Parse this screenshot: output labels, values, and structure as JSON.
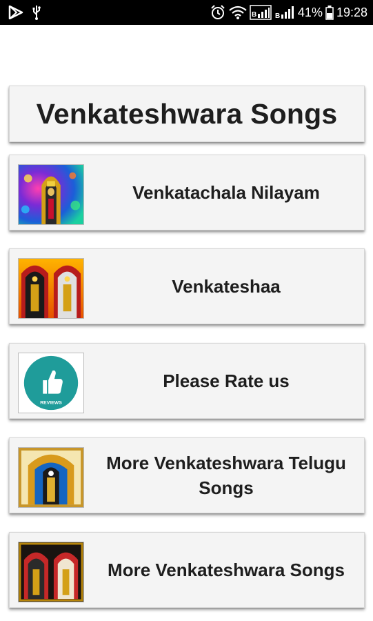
{
  "status_bar": {
    "battery_percent": "41%",
    "time": "19:28",
    "icons": [
      "play-store-icon",
      "usb-icon",
      "alarm-icon",
      "wifi-icon",
      "signal-icon",
      "signal-icon",
      "battery-icon"
    ]
  },
  "header": {
    "title": "Venkateshwara Songs"
  },
  "menu": {
    "items": [
      {
        "label": "Venkatachala Nilayam",
        "image": "deity-on-colorful-background"
      },
      {
        "label": "Venkateshaa",
        "image": "two-deities"
      },
      {
        "label": "Please Rate us",
        "image": "reviews-thumbs-up",
        "badge": "REVIEWS"
      },
      {
        "label": "More Venkateshwara Telugu Songs",
        "image": "deity-golden-frame"
      },
      {
        "label": "More Venkateshwara Songs",
        "image": "two-deities-dark"
      }
    ]
  },
  "colors": {
    "status_bar": "#000000",
    "card_bg": "#f4f4f4",
    "reviews_teal": "#1f9c9a",
    "text": "#1e1e1e"
  }
}
